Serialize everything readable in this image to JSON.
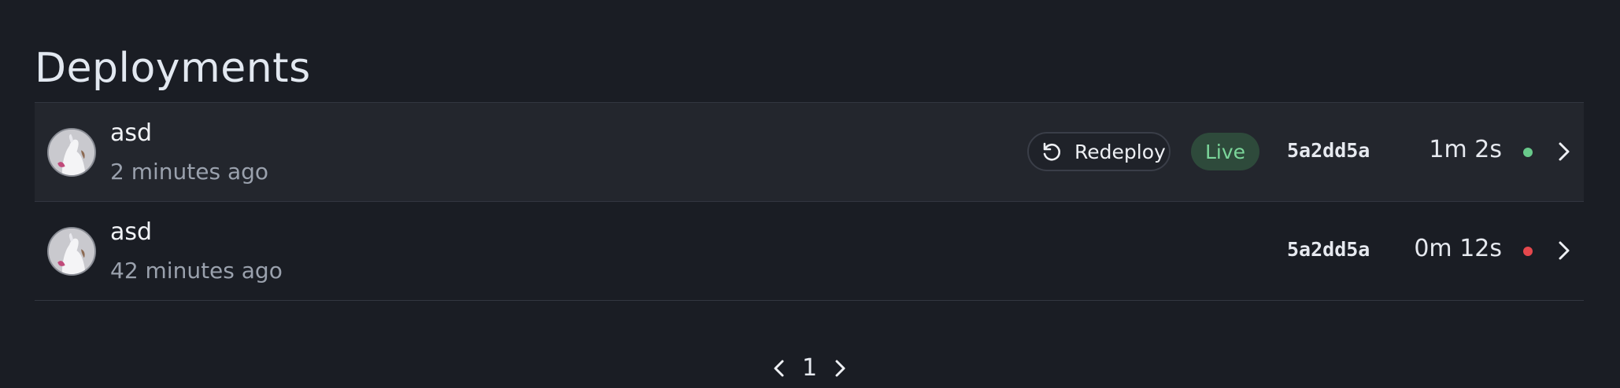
{
  "page": {
    "title": "Deployments"
  },
  "deployments": [
    {
      "title": "asd",
      "time_ago": "2 minutes ago",
      "redeploy_label": "Redeploy",
      "status_badge": "Live",
      "commit": "5a2dd5a",
      "duration": "1m 2s",
      "status_color": "#68c98a"
    },
    {
      "title": "asd",
      "time_ago": "42 minutes ago",
      "commit": "5a2dd5a",
      "duration": "0m 12s",
      "status_color": "#e5484d"
    }
  ],
  "pagination": {
    "current_page": "1"
  },
  "icons": {
    "avatar": "avatar",
    "redeploy": "rotate-ccw-icon",
    "row_action": "chevron-right-icon",
    "prev": "chevron-left-icon",
    "next": "chevron-right-icon"
  },
  "colors": {
    "background": "#1a1d24",
    "row_highlight": "#23262d",
    "live_badge_bg": "#2e4a3b",
    "live_badge_text": "#7bd69a"
  }
}
